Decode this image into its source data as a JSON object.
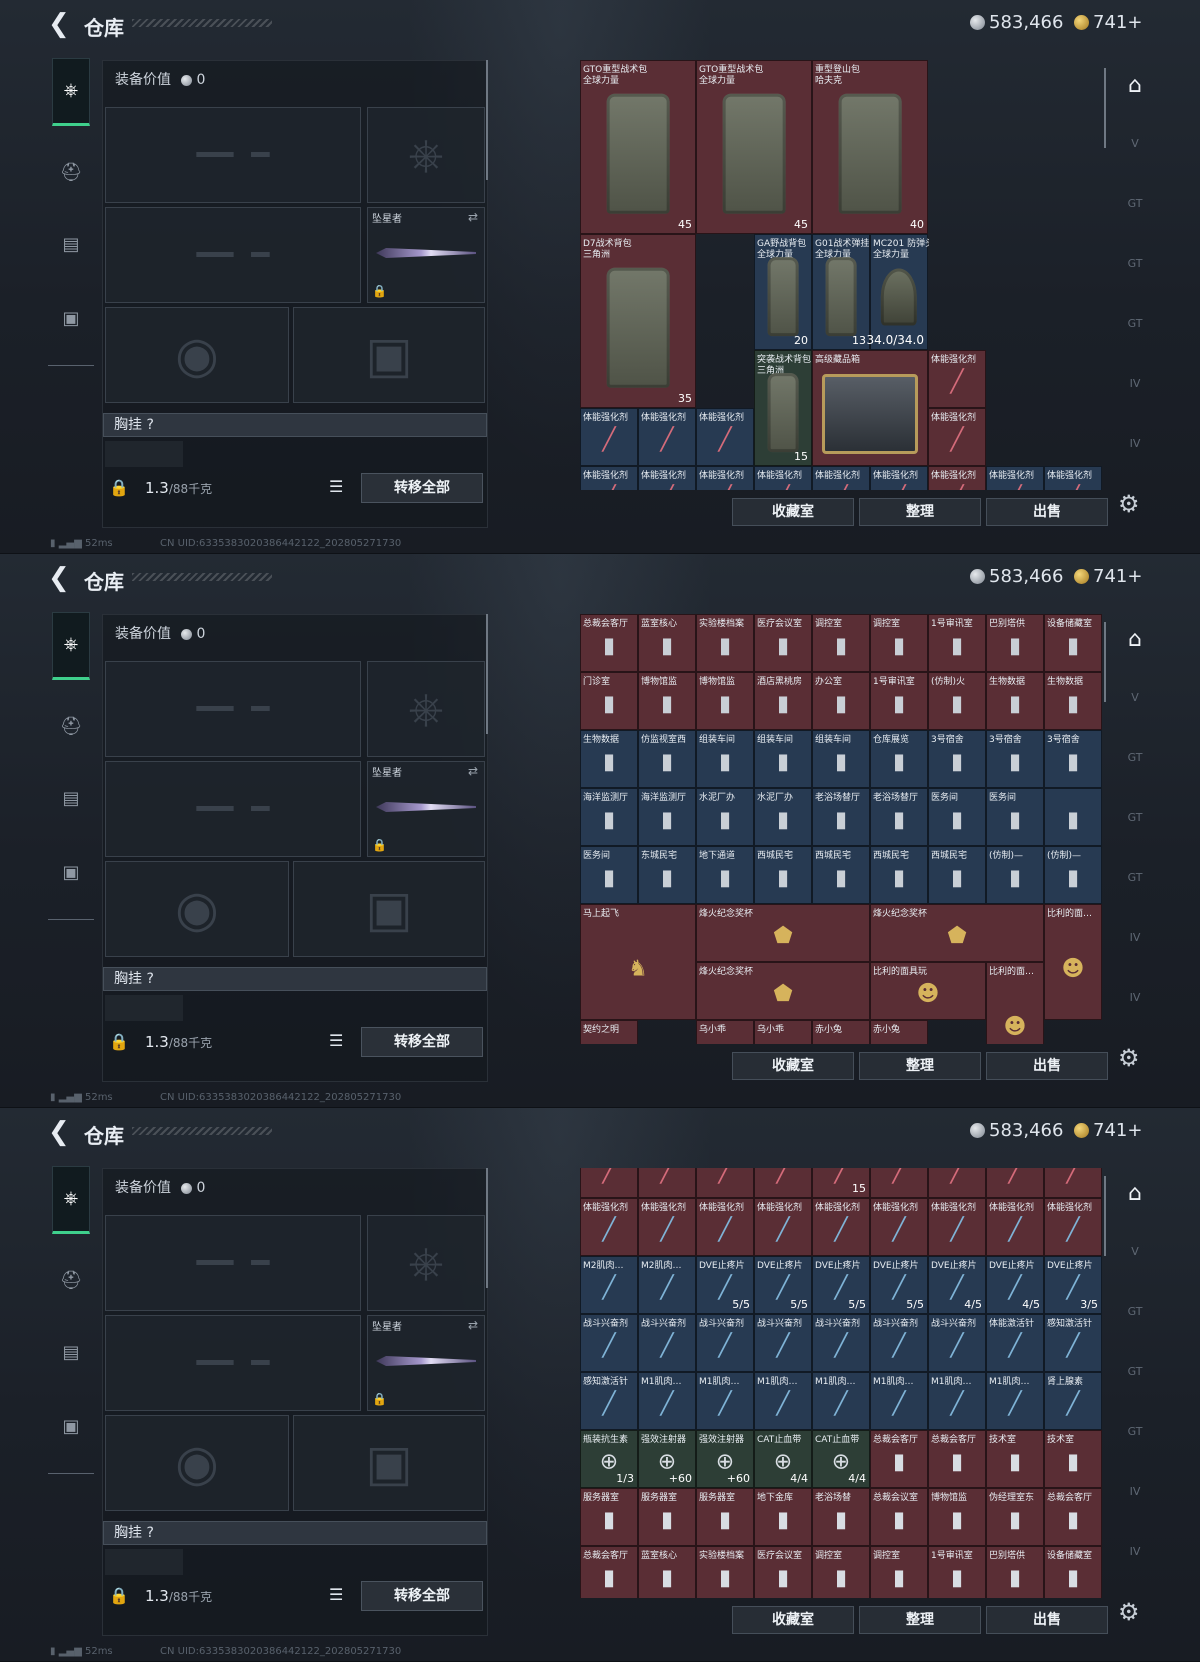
{
  "header": {
    "title": "仓库",
    "silver": "583,466",
    "gold": "741+"
  },
  "equipment": {
    "value_label": "装备价值",
    "value": "0",
    "pendant_label": "坠星者",
    "chest_label": "胸挂",
    "chest_help": "?",
    "weight": "1.3",
    "weight_max": "/88千克",
    "transfer_all": "转移全部"
  },
  "actions": {
    "collection": "收藏室",
    "sort": "整理",
    "sell": "出售"
  },
  "status": {
    "ping": "52ms",
    "uid": "CN UID:6335383020386442122_202805271730"
  },
  "right_tabs": [
    "V",
    "GT",
    "GT",
    "GT",
    "IV",
    "IV"
  ],
  "panels": [
    {
      "cells": [
        {
          "label": "GTO重型战术包",
          "sub": "全球力量",
          "color": "red",
          "count": "45"
        },
        {
          "label": "GTO重型战术包",
          "sub": "全球力量",
          "color": "red",
          "count": "45"
        },
        {
          "label": "重型登山包",
          "sub": "哈夫克",
          "color": "red",
          "count": "40"
        },
        {
          "label": "D7战术背包",
          "sub": "三角洲",
          "color": "red",
          "count": "35"
        },
        {
          "label": "GA野战背包",
          "sub": "全球力量",
          "color": "blue",
          "count": "20"
        },
        {
          "label": "G01战术弹挂",
          "sub": "全球力量",
          "color": "blue",
          "count": "13"
        },
        {
          "label": "MC201 防弹头盔",
          "sub": "全球力量",
          "color": "blue",
          "count": "34.0/34.0"
        },
        {
          "label": "突袭战术背包",
          "sub": "三角洲",
          "color": "green",
          "count": "15"
        },
        {
          "label": "高级藏品箱",
          "sub": "",
          "color": "red",
          "count": ""
        },
        {
          "label": "体能强化剂",
          "sub": "",
          "color": "red",
          "count": ""
        }
      ]
    },
    {
      "rows": [
        [
          "总裁会客厅",
          "蓝室核心",
          "实验楼档案",
          "医疗会议室",
          "调控室",
          "调控室",
          "1号审讯室",
          "巴别塔供",
          "设备储藏室"
        ],
        [
          "门诊室",
          "博物馆监",
          "博物馆监",
          "酒店黑桃房",
          "办公室",
          "1号审讯室",
          "(仿制)火",
          "生物数据",
          "生物数据"
        ],
        [
          "生物数据",
          "仿监视室西",
          "组装车间",
          "组装车间",
          "组装车间",
          "仓库展览",
          "3号宿舍",
          "3号宿舍",
          "3号宿舍"
        ],
        [
          "海洋监测厅",
          "海洋监测厅",
          "水泥厂办",
          "水泥厂办",
          "老浴场替厅",
          "老浴场替厅",
          "医务间",
          "医务间",
          ""
        ],
        [
          "医务间",
          "东城民宅",
          "地下通道",
          "西城民宅",
          "西城民宅",
          "西城民宅",
          "西城民宅",
          "(仿制)—",
          "(仿制)—"
        ]
      ],
      "specials": [
        {
          "label": "马上起飞"
        },
        {
          "label": "烽火纪念奖杯"
        },
        {
          "label": "烽火纪念奖杯"
        },
        {
          "label": "比利的面…"
        },
        {
          "label": "烽火纪念奖杯"
        },
        {
          "label": "比利的面具玩"
        },
        {
          "label": "比利的面…"
        }
      ],
      "bottom_labels": [
        "契约之明",
        "乌小乖",
        "乌小乖",
        "赤小兔",
        "赤小兔"
      ]
    },
    {
      "rows": [
        [
          {
            "l": "体能强化剂",
            "c": ""
          },
          {
            "l": "体能强化剂",
            "c": ""
          },
          {
            "l": "体能强化剂",
            "c": ""
          },
          {
            "l": "体能强化剂",
            "c": ""
          },
          {
            "l": "体能强化剂",
            "c": ""
          },
          {
            "l": "体能强化剂",
            "c": ""
          },
          {
            "l": "体能强化剂",
            "c": ""
          },
          {
            "l": "体能强化剂",
            "c": ""
          },
          {
            "l": "体能强化剂",
            "c": ""
          }
        ],
        [
          {
            "l": "M2肌肉…",
            "c": ""
          },
          {
            "l": "M2肌肉…",
            "c": ""
          },
          {
            "l": "DVE止疼片",
            "c": "5/5"
          },
          {
            "l": "DVE止疼片",
            "c": "5/5"
          },
          {
            "l": "DVE止疼片",
            "c": "5/5"
          },
          {
            "l": "DVE止疼片",
            "c": "5/5"
          },
          {
            "l": "DVE止疼片",
            "c": "4/5"
          },
          {
            "l": "DVE止疼片",
            "c": "4/5"
          },
          {
            "l": "DVE止疼片",
            "c": "3/5"
          }
        ],
        [
          {
            "l": "战斗兴奋剂",
            "c": ""
          },
          {
            "l": "战斗兴奋剂",
            "c": ""
          },
          {
            "l": "战斗兴奋剂",
            "c": ""
          },
          {
            "l": "战斗兴奋剂",
            "c": ""
          },
          {
            "l": "战斗兴奋剂",
            "c": ""
          },
          {
            "l": "战斗兴奋剂",
            "c": ""
          },
          {
            "l": "战斗兴奋剂",
            "c": ""
          },
          {
            "l": "体能激活针",
            "c": ""
          },
          {
            "l": "感知激活针",
            "c": ""
          }
        ],
        [
          {
            "l": "感知激活针",
            "c": ""
          },
          {
            "l": "M1肌肉…",
            "c": ""
          },
          {
            "l": "M1肌肉…",
            "c": ""
          },
          {
            "l": "M1肌肉…",
            "c": ""
          },
          {
            "l": "M1肌肉…",
            "c": ""
          },
          {
            "l": "M1肌肉…",
            "c": ""
          },
          {
            "l": "M1肌肉…",
            "c": ""
          },
          {
            "l": "M1肌肉…",
            "c": ""
          },
          {
            "l": "肾上腺素",
            "c": ""
          }
        ],
        [
          {
            "l": "瓶装抗生素",
            "c": "1/3"
          },
          {
            "l": "强效注射器",
            "c": "+60"
          },
          {
            "l": "强效注射器",
            "c": "+60"
          },
          {
            "l": "CAT止血带",
            "c": "4/4"
          },
          {
            "l": "CAT止血带",
            "c": "4/4"
          },
          {
            "l": "总裁会客厅",
            "c": ""
          },
          {
            "l": "总裁会客厅",
            "c": ""
          },
          {
            "l": "技术室",
            "c": ""
          },
          {
            "l": "技术室",
            "c": ""
          }
        ],
        [
          {
            "l": "服务器室",
            "c": ""
          },
          {
            "l": "服务器室",
            "c": ""
          },
          {
            "l": "服务器室",
            "c": ""
          },
          {
            "l": "地下金库",
            "c": ""
          },
          {
            "l": "老浴场替",
            "c": ""
          },
          {
            "l": "总裁会议室",
            "c": ""
          },
          {
            "l": "博物馆监",
            "c": ""
          },
          {
            "l": "伪经理室东",
            "c": ""
          },
          {
            "l": "总裁会客厅",
            "c": ""
          }
        ],
        [
          {
            "l": "总裁会客厅",
            "c": ""
          },
          {
            "l": "蓝室核心",
            "c": ""
          },
          {
            "l": "实验楼档案",
            "c": ""
          },
          {
            "l": "医疗会议室",
            "c": ""
          },
          {
            "l": "调控室",
            "c": ""
          },
          {
            "l": "调控室",
            "c": ""
          },
          {
            "l": "1号审讯室",
            "c": ""
          },
          {
            "l": "巴别塔供",
            "c": ""
          },
          {
            "l": "设备储藏室",
            "c": ""
          }
        ]
      ],
      "top_count": "15"
    }
  ]
}
